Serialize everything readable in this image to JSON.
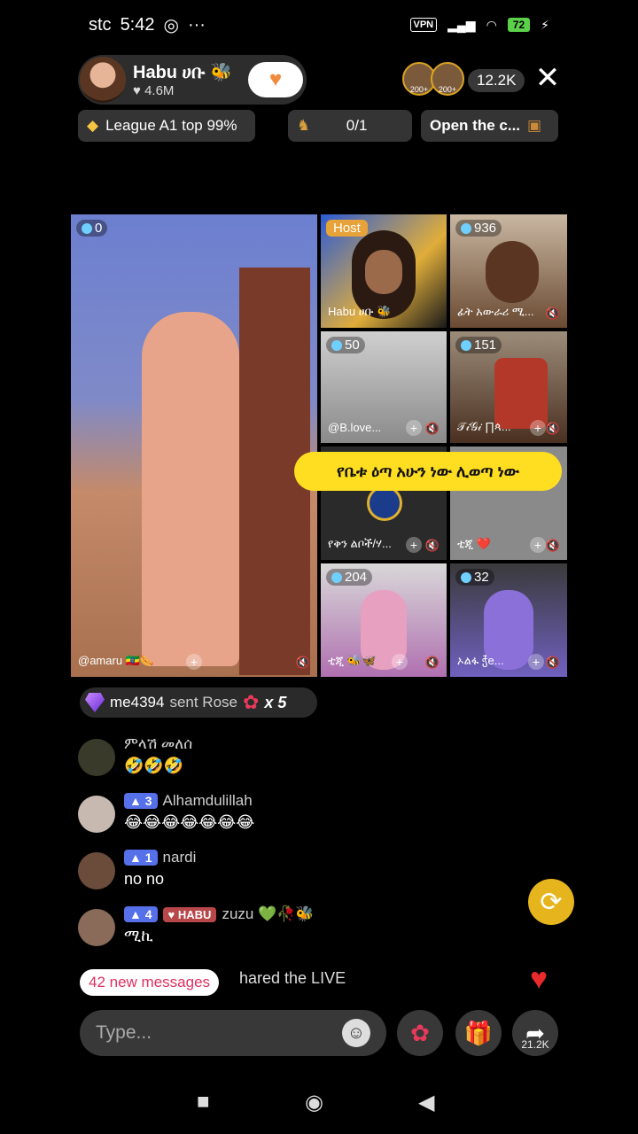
{
  "status_bar": {
    "carrier": "stc",
    "time": "5:42",
    "vpn": "VPN",
    "battery": "72"
  },
  "host": {
    "name": "Habu ሀቡ 🐝",
    "likes": "♥ 4.6M",
    "follow_icon": "heart-icon"
  },
  "viewers": {
    "avatar_labels": [
      "200+",
      "200+"
    ],
    "count": "12.2K"
  },
  "close": "✕",
  "chips": {
    "league": "League A1 top 99%",
    "score": "0/1",
    "open": "Open the c..."
  },
  "tiles": [
    {
      "badge": "0",
      "name": "@amaru 🇪🇹🌭"
    },
    {
      "badge": "Host",
      "name": "Habu ሀቡ 🐝"
    },
    {
      "badge": "936",
      "name": "ፊት አውራሪ ሚ..."
    },
    {
      "badge": "50",
      "name": "@B.love..."
    },
    {
      "badge": "151",
      "name": "𝒯𝒾𝒢𝒾 ∏ጳ..."
    },
    {
      "badge": "",
      "name": "የቅን ልቦች/ሃ..."
    },
    {
      "badge": "",
      "name": "ቲጂ ❤️"
    },
    {
      "badge": "204",
      "name": "ቲጂ 🐝🦋"
    },
    {
      "badge": "32",
      "name": "ኦልፋ ჭ̈e..."
    }
  ],
  "banner": "የቤቱ ዕጣ አሁን ነው ሊወጣ ነው",
  "gift": {
    "user": "me4394",
    "action": "sent Rose",
    "count": "x 5"
  },
  "comments": [
    {
      "user": "ምላሽ መለሰ",
      "level": "",
      "fan": "",
      "text": "🤣🤣🤣",
      "avatar_color": "#3a3a2a"
    },
    {
      "user": "Alhamdulillah",
      "level": "3",
      "fan": "",
      "text": "😂😂😂😂😂😂😂",
      "avatar_color": "#c7b8b0"
    },
    {
      "user": "nardi",
      "level": "1",
      "fan": "",
      "text": "no no",
      "avatar_color": "#6b4c3b"
    },
    {
      "user": "zuzu 💚🥀🐝",
      "level": "4",
      "fan": "HABU",
      "text": "ሚኪ",
      "avatar_color": "#8a6b5a"
    }
  ],
  "shared_text": "hared the LIVE",
  "new_messages": "42 new messages",
  "input": {
    "placeholder": "Type..."
  },
  "share_count": "21.2K",
  "colors": {
    "accent_yellow": "#ffde22",
    "level_blue": "#5570e8",
    "heart_red": "#e82a2a",
    "new_msg_pink": "#e03060"
  }
}
